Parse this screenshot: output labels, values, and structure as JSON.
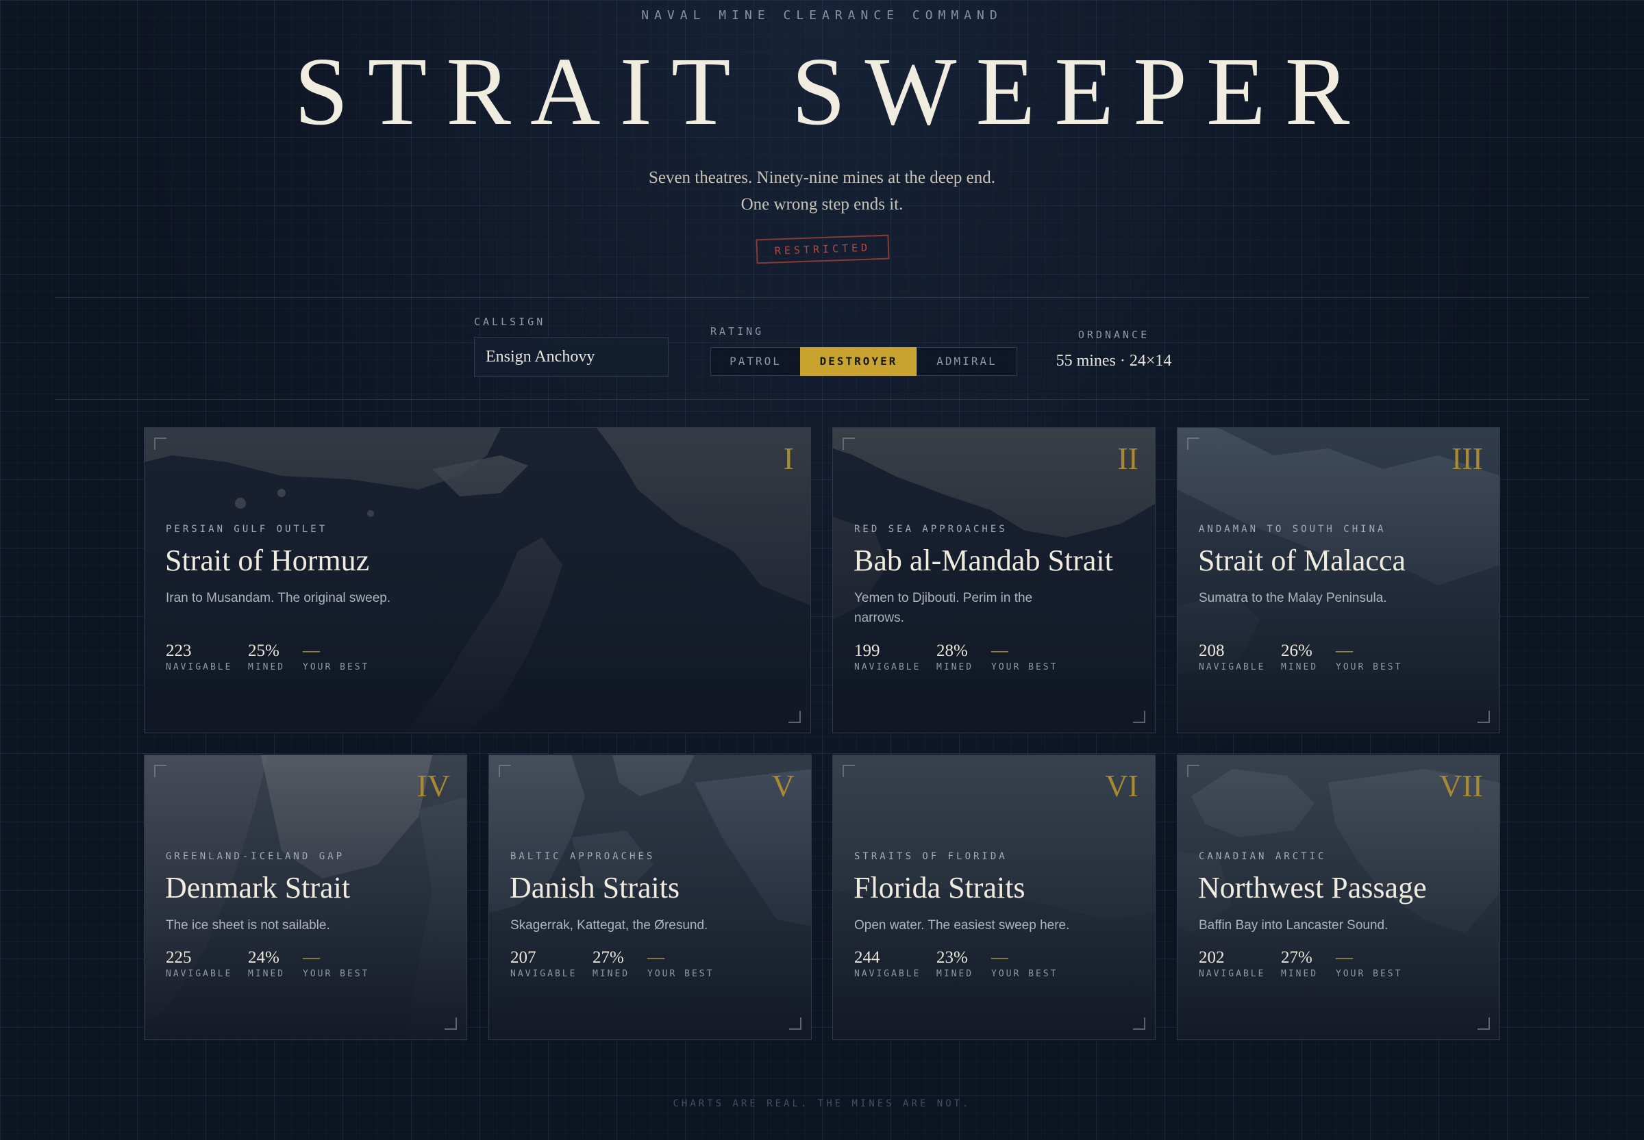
{
  "header": {
    "eyebrow": "NAVAL MINE CLEARANCE COMMAND",
    "title": "STRAIT SWEEPER",
    "tagline_1": "Seven theatres. Ninety-nine mines at the deep end.",
    "tagline_2": "One wrong step ends it.",
    "stamp": "RESTRICTED"
  },
  "controls": {
    "callsign_label": "CALLSIGN",
    "callsign_value": "Ensign Anchovy",
    "rating_label": "RATING",
    "rating_options": [
      "PATROL",
      "DESTROYER",
      "ADMIRAL"
    ],
    "rating_selected": "DESTROYER",
    "ordnance_label": "ORDNANCE",
    "ordnance_value": "55 mines · 24×14"
  },
  "stat_labels": {
    "navigable": "NAVIGABLE",
    "mined": "MINED",
    "best": "YOUR BEST"
  },
  "theatres": [
    {
      "numeral": "I",
      "region": "PERSIAN GULF OUTLET",
      "name": "Strait of Hormuz",
      "desc": "Iran to Musandam. The original sweep.",
      "navigable": "223",
      "mined": "25%",
      "best": "—",
      "map": "hormuz"
    },
    {
      "numeral": "II",
      "region": "RED SEA APPROACHES",
      "name": "Bab al-Mandab Strait",
      "desc": "Yemen to Djibouti. Perim in the narrows.",
      "navigable": "199",
      "mined": "28%",
      "best": "—",
      "map": "mandab"
    },
    {
      "numeral": "III",
      "region": "ANDAMAN TO SOUTH CHINA",
      "name": "Strait of Malacca",
      "desc": "Sumatra to the Malay Peninsula.",
      "navigable": "208",
      "mined": "26%",
      "best": "—",
      "map": "malacca"
    },
    {
      "numeral": "IV",
      "region": "GREENLAND-ICELAND GAP",
      "name": "Denmark Strait",
      "desc": "The ice sheet is not sailable.",
      "navigable": "225",
      "mined": "24%",
      "best": "—",
      "map": "denmark"
    },
    {
      "numeral": "V",
      "region": "BALTIC APPROACHES",
      "name": "Danish Straits",
      "desc": "Skagerrak, Kattegat, the Øresund.",
      "navigable": "207",
      "mined": "27%",
      "best": "—",
      "map": "danish"
    },
    {
      "numeral": "VI",
      "region": "STRAITS OF FLORIDA",
      "name": "Florida Straits",
      "desc": "Open water. The easiest sweep here.",
      "navigable": "244",
      "mined": "23%",
      "best": "—",
      "map": "florida"
    },
    {
      "numeral": "VII",
      "region": "CANADIAN ARCTIC",
      "name": "Northwest Passage",
      "desc": "Baffin Bay into Lancaster Sound.",
      "navigable": "202",
      "mined": "27%",
      "best": "—",
      "map": "northwest"
    }
  ],
  "footer": "CHARTS ARE REAL. THE MINES ARE NOT."
}
